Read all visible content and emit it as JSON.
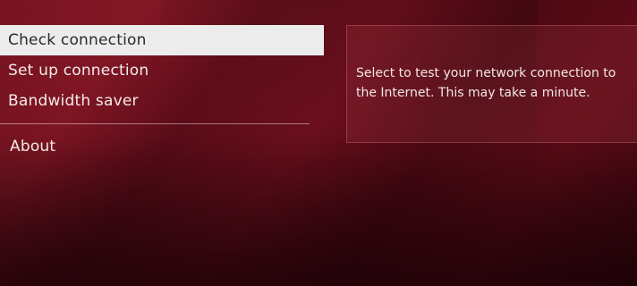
{
  "menu": {
    "items": [
      {
        "label": "Check connection",
        "selected": true
      },
      {
        "label": "Set up connection",
        "selected": false
      },
      {
        "label": "Bandwidth saver",
        "selected": false
      }
    ],
    "about_label": "About"
  },
  "info": {
    "lines": [
      "Select to test your network connection to",
      "the Internet. This may take a minute."
    ]
  },
  "colors": {
    "background": "#5e0c18",
    "selected_bg": "#ececec",
    "selected_text": "#2a2a2a",
    "text": "#f4eaea"
  }
}
